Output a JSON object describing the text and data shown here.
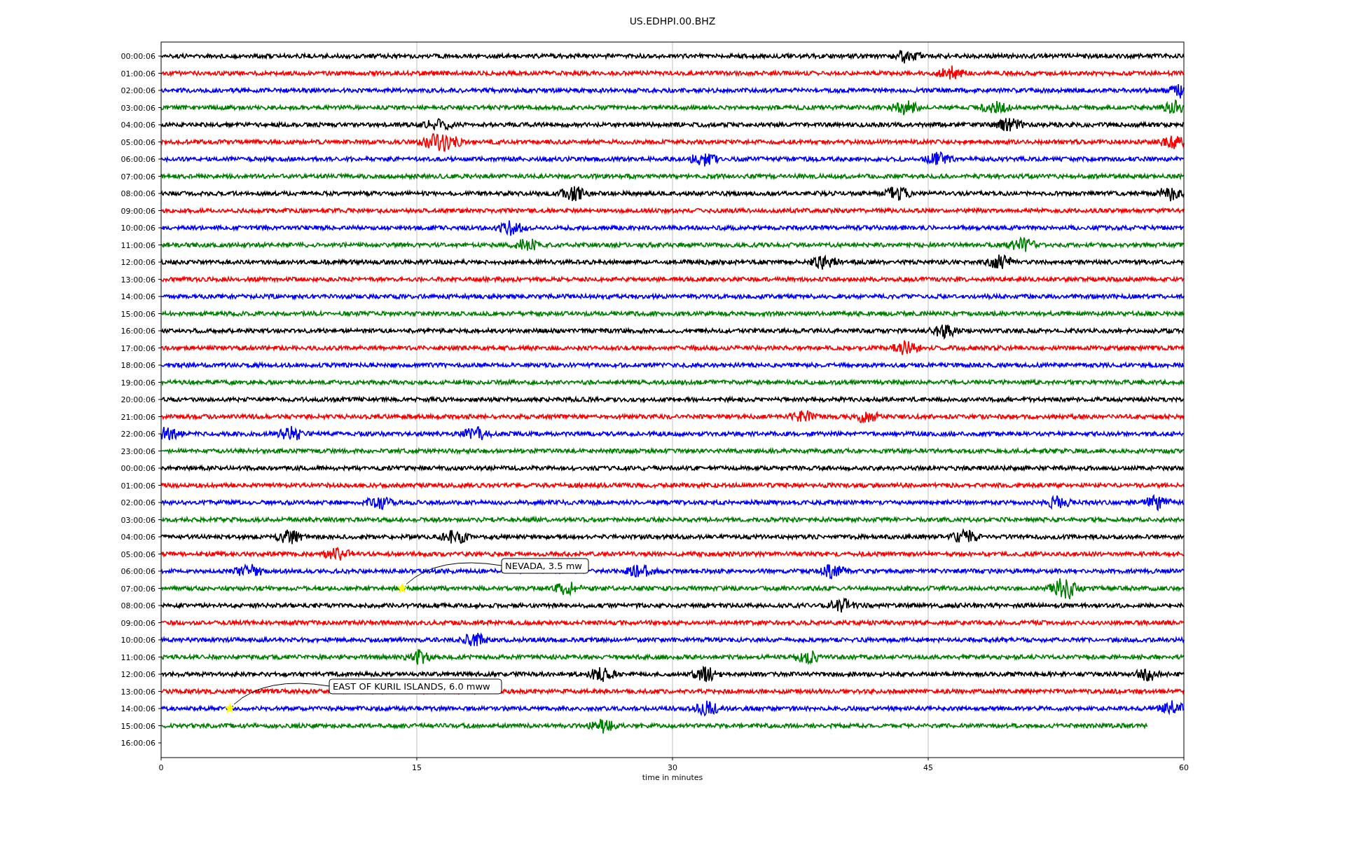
{
  "title": "US.EDHPI.00.BHZ",
  "xlabel": "time in minutes",
  "xticks": [
    "0",
    "15",
    "30",
    "45",
    "60"
  ],
  "rows": [
    {
      "label": "00:00:06",
      "color": "#000000",
      "level": 1
    },
    {
      "label": "01:00:06",
      "color": "#ff0000",
      "level": 1
    },
    {
      "label": "02:00:06",
      "color": "#0000ff",
      "level": 1
    },
    {
      "label": "03:00:06",
      "color": "#008000",
      "level": 1
    },
    {
      "label": "04:00:06",
      "color": "#000000",
      "level": 1
    },
    {
      "label": "05:00:06",
      "color": "#ff0000",
      "level": 1
    },
    {
      "label": "06:00:06",
      "color": "#0000ff",
      "level": 1
    },
    {
      "label": "07:00:06",
      "color": "#008000",
      "level": 1
    },
    {
      "label": "08:00:06",
      "color": "#000000",
      "level": 1
    },
    {
      "label": "09:00:06",
      "color": "#ff0000",
      "level": 1
    },
    {
      "label": "10:00:06",
      "color": "#0000ff",
      "level": 1
    },
    {
      "label": "11:00:06",
      "color": "#008000",
      "level": 1
    },
    {
      "label": "12:00:06",
      "color": "#000000",
      "level": 1
    },
    {
      "label": "13:00:06",
      "color": "#ff0000",
      "level": 1
    },
    {
      "label": "14:00:06",
      "color": "#0000ff",
      "level": 1
    },
    {
      "label": "15:00:06",
      "color": "#008000",
      "level": 1
    },
    {
      "label": "16:00:06",
      "color": "#000000",
      "level": 1
    },
    {
      "label": "17:00:06",
      "color": "#ff0000",
      "level": 1
    },
    {
      "label": "18:00:06",
      "color": "#0000ff",
      "level": 1
    },
    {
      "label": "19:00:06",
      "color": "#008000",
      "level": 1
    },
    {
      "label": "20:00:06",
      "color": "#000000",
      "level": 1
    },
    {
      "label": "21:00:06",
      "color": "#ff0000",
      "level": 1
    },
    {
      "label": "22:00:06",
      "color": "#0000ff",
      "level": 1
    },
    {
      "label": "23:00:06",
      "color": "#008000",
      "level": 1
    },
    {
      "label": "00:00:06",
      "color": "#000000",
      "level": 1
    },
    {
      "label": "01:00:06",
      "color": "#ff0000",
      "level": 1
    },
    {
      "label": "02:00:06",
      "color": "#0000ff",
      "level": 1
    },
    {
      "label": "03:00:06",
      "color": "#008000",
      "level": 1
    },
    {
      "label": "04:00:06",
      "color": "#000000",
      "level": 1
    },
    {
      "label": "05:00:06",
      "color": "#ff0000",
      "level": 1
    },
    {
      "label": "06:00:06",
      "color": "#0000ff",
      "level": 1
    },
    {
      "label": "07:00:06",
      "color": "#008000",
      "level": 1
    },
    {
      "label": "08:00:06",
      "color": "#000000",
      "level": 1
    },
    {
      "label": "09:00:06",
      "color": "#ff0000",
      "level": 1
    },
    {
      "label": "10:00:06",
      "color": "#0000ff",
      "level": 1
    },
    {
      "label": "11:00:06",
      "color": "#008000",
      "level": 1
    },
    {
      "label": "12:00:06",
      "color": "#000000",
      "level": 1
    },
    {
      "label": "13:00:06",
      "color": "#ff0000",
      "level": 1
    },
    {
      "label": "14:00:06",
      "color": "#0000ff",
      "level": 1
    },
    {
      "label": "15:00:06",
      "color": "#008000",
      "level": 0.965
    },
    {
      "label": "16:00:06"
    }
  ],
  "annotations": [
    "NEVADA, 3.5 mw",
    "EAST OF KURIL ISLANDS, 6.0 mww"
  ]
}
